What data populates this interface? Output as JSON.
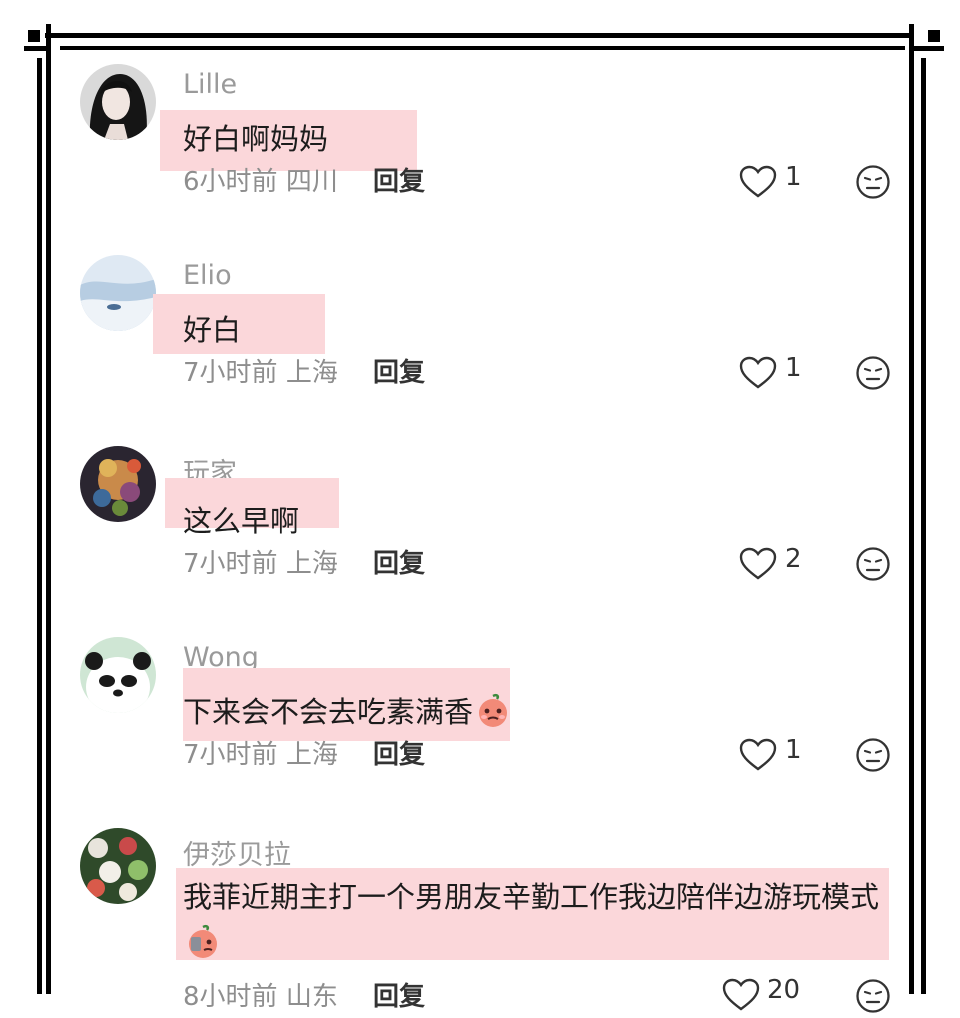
{
  "comments": [
    {
      "username": "Lille",
      "text": "好白啊妈妈",
      "time": "6小时前",
      "location": "四川",
      "reply_label": "回复",
      "likes": "1",
      "avatar_icon": "woman-portrait-avatar"
    },
    {
      "username": "Elio",
      "text": "好白",
      "time": "7小时前",
      "location": "上海",
      "reply_label": "回复",
      "likes": "1",
      "avatar_icon": "snow-landscape-avatar"
    },
    {
      "username": "玩家",
      "text": "这么早啊",
      "time": "7小时前",
      "location": "上海",
      "reply_label": "回复",
      "likes": "2",
      "avatar_icon": "colorful-art-avatar"
    },
    {
      "username": "Wong",
      "text": "下来会不会去吃素满香",
      "time": "7小时前",
      "location": "上海",
      "reply_label": "回复",
      "likes": "1",
      "avatar_icon": "panda-avatar",
      "emoji_icon": "pleading-peach-emoji"
    },
    {
      "username": "伊莎贝拉",
      "text": "我菲近期主打一个男朋友辛勤工作我边陪伴边游玩模式",
      "time": "8小时前",
      "location": "山东",
      "reply_label": "回复",
      "likes": "20",
      "avatar_icon": "flowers-avatar",
      "emoji_icon": "peach-phone-emoji"
    }
  ],
  "colors": {
    "highlight": "#fbd7da",
    "username": "#9a9a9a",
    "meta": "#8e8e8e",
    "text": "#1c1c1c",
    "frame": "#000000"
  }
}
